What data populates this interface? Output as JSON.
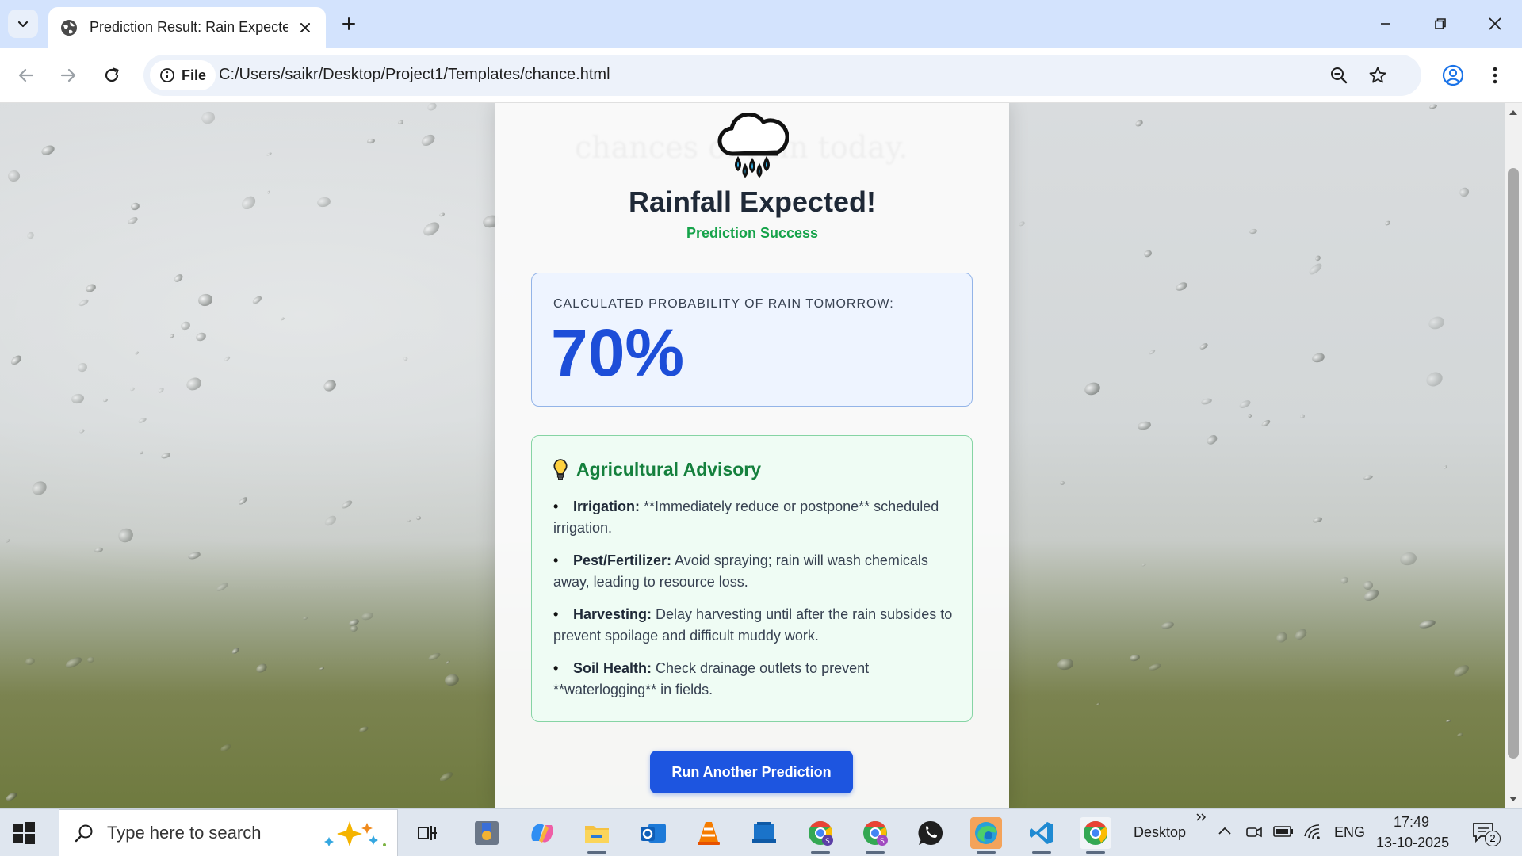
{
  "browser": {
    "tab_title": "Prediction Result: Rain Expected",
    "file_chip": "File",
    "url": "C:/Users/saikr/Desktop/Project1/Templates/chance.html"
  },
  "page": {
    "background_text": "chances of rain today.",
    "title": "Rainfall Expected!",
    "subtitle": "Prediction Success",
    "probability_label": "CALCULATED PROBABILITY OF RAIN TOMORROW:",
    "probability_value": "70%",
    "advisory": {
      "title": "Agricultural Advisory",
      "items": [
        {
          "bullet": "•",
          "label": "Irrigation:",
          "text": " **Immediately reduce or postpone** scheduled irrigation."
        },
        {
          "bullet": "•",
          "label": "Pest/Fertilizer:",
          "text": " Avoid spraying; rain will wash chemicals away, leading to resource loss."
        },
        {
          "bullet": "•",
          "label": "Harvesting:",
          "text": " Delay harvesting until after the rain subsides to prevent spoilage and difficult muddy work."
        },
        {
          "bullet": "•",
          "label": "Soil Health:",
          "text": " Check drainage outlets to prevent **waterlogging** in fields."
        }
      ]
    },
    "button_label": "Run Another Prediction"
  },
  "taskbar": {
    "search_placeholder": "Type here to search",
    "desktop_label": "Desktop",
    "language": "ENG",
    "time": "17:49",
    "date": "13-10-2025",
    "notification_count": "2"
  },
  "colors": {
    "accent_blue": "#1d55e0",
    "success_green": "#16a34a",
    "advisory_green": "#15803d",
    "probability_blue": "#1d4ed8"
  }
}
